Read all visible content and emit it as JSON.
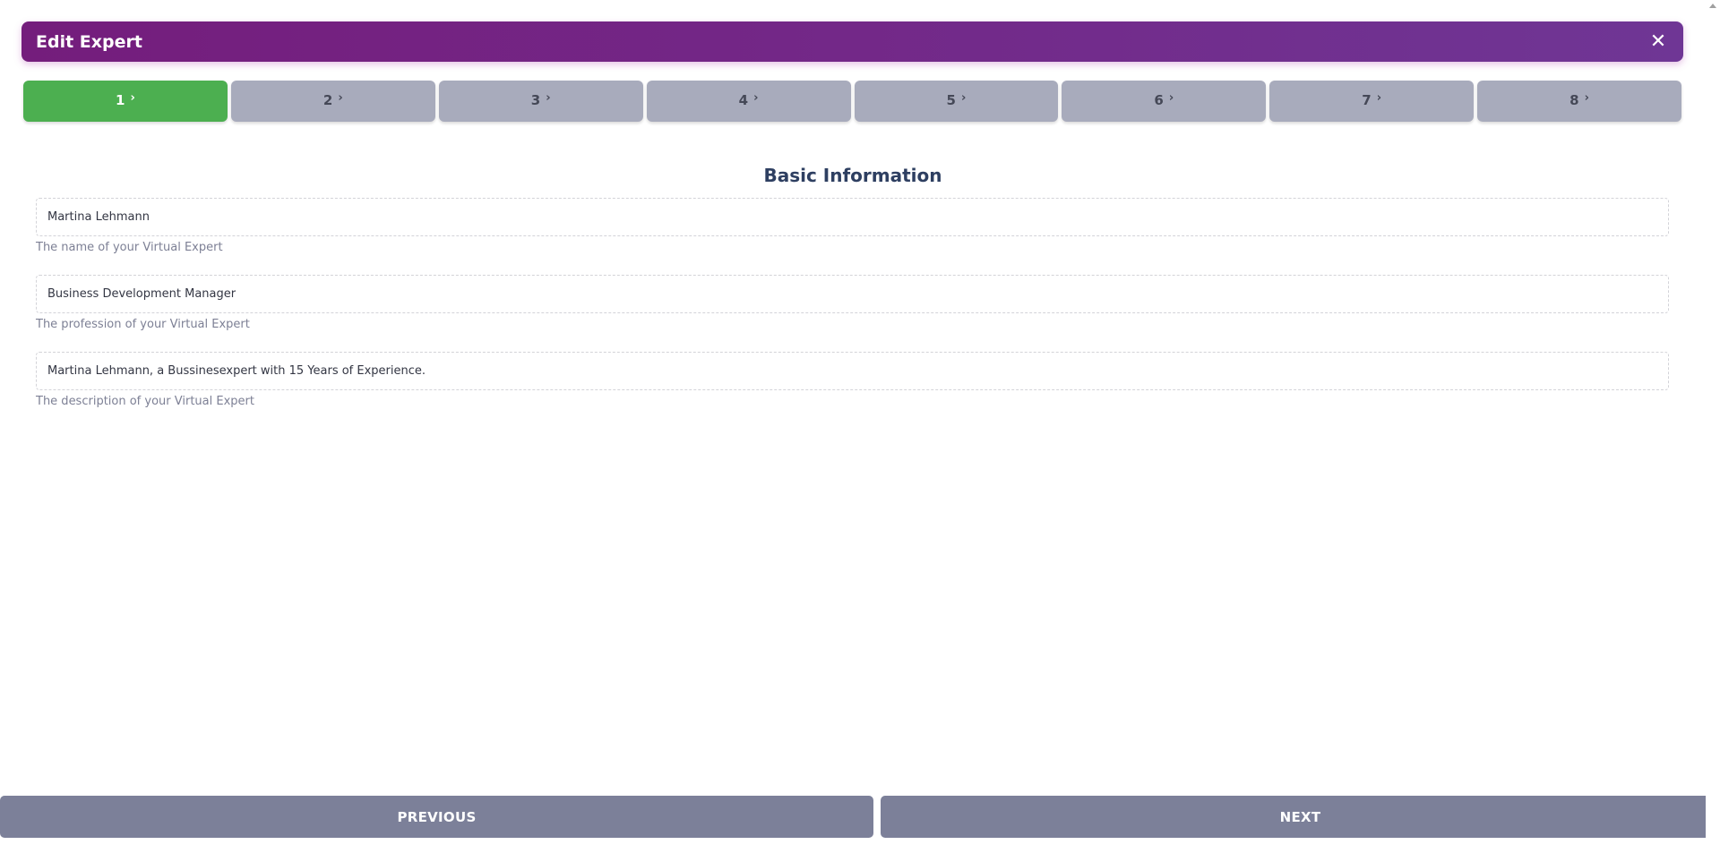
{
  "header": {
    "title": "Edit Expert",
    "close_icon": "close-icon"
  },
  "steps": [
    {
      "label": "1",
      "active": true
    },
    {
      "label": "2",
      "active": false
    },
    {
      "label": "3",
      "active": false
    },
    {
      "label": "4",
      "active": false
    },
    {
      "label": "5",
      "active": false
    },
    {
      "label": "6",
      "active": false
    },
    {
      "label": "7",
      "active": false
    },
    {
      "label": "8",
      "active": false
    }
  ],
  "step_chevron_icon": "chevron-right-icon",
  "section": {
    "title": "Basic Information"
  },
  "fields": {
    "name": {
      "value": "Martina Lehmann",
      "helper": "The name of your Virtual Expert"
    },
    "profession": {
      "value": "Business Development Manager",
      "helper": "The profession of your Virtual Expert"
    },
    "description": {
      "value": "Martina Lehmann, a Bussinesexpert with 15 Years of Experience.",
      "helper": "The description of your Virtual Expert"
    }
  },
  "footer": {
    "previous_label": "PREVIOUS",
    "next_label": "NEXT"
  },
  "colors": {
    "header_gradient_start": "#741d7c",
    "header_gradient_end": "#6f3695",
    "step_active": "#4caf50",
    "step_inactive": "#a8abbc",
    "footer_button": "#7c8099",
    "section_title": "#2e3f61"
  }
}
